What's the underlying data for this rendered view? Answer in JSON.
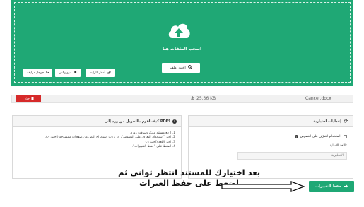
{
  "upload": {
    "title": "اسحب الملفات هنا",
    "choose_button": "اختيار ملف",
    "sources": [
      {
        "icon": "google-icon",
        "label": "جوجل درايف"
      },
      {
        "icon": "dropbox-icon",
        "label": "دروبوكس"
      },
      {
        "icon": "link-icon",
        "label": "أدخل الرابط"
      }
    ]
  },
  "file": {
    "delete_label": "حذف",
    "size": "25.36 KB",
    "name": "Cancer.docx"
  },
  "help": {
    "title": "كيف أقوم بالتحويل من ورد إلى PDF؟",
    "steps": [
      "1. ارفع مستند مايكروسوفت وورد.",
      "2. اختر \"استخدام التعرّف على النصوص\"، إذا أردت استخراج النص من صفحات ممسوحة (اختياري).",
      "3. اختر اللغة (اختياري)",
      "4. اضغط على \"حفظ التغييرات\"."
    ]
  },
  "settings": {
    "title": "إعدادات اختيارية",
    "ocr_label": "استخدام التعرّف على النصوص:",
    "language_label": "اللغة الأصلية:",
    "language_value": "الإنجليزية"
  },
  "annotation": {
    "line1": "بعد اختيارك للمستند انتظر ثوانى ثم",
    "line2": "اضغط على حفظ الغيرات"
  },
  "save_button": "حفظ التغييرات",
  "colors": {
    "accent": "#1fa875",
    "danger": "#d62a2a"
  }
}
